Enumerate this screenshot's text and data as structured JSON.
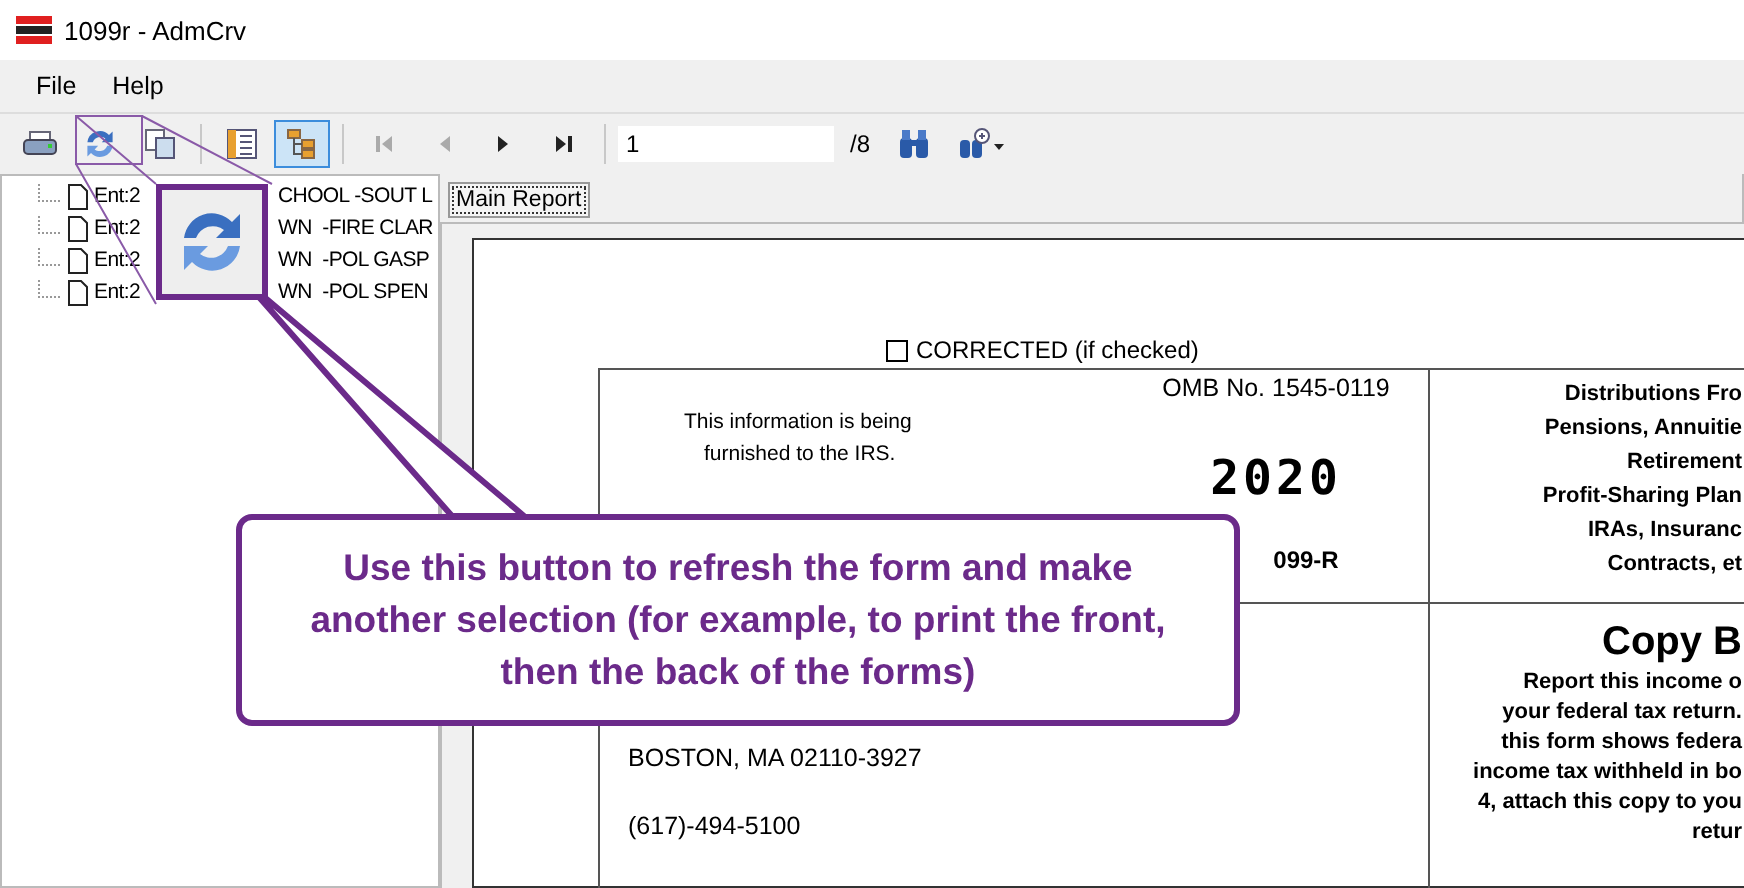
{
  "window": {
    "title": "1099r - AdmCrv"
  },
  "menu": [
    "File",
    "Help"
  ],
  "toolbar": [
    {
      "kind": "print"
    },
    {
      "kind": "refresh"
    },
    {
      "kind": "copy"
    },
    {
      "kind": "sep"
    },
    {
      "kind": "list",
      "pressed": false
    },
    {
      "kind": "tree",
      "pressed": true
    },
    {
      "kind": "sep"
    },
    {
      "kind": "first",
      "disabled": true
    },
    {
      "kind": "prev",
      "disabled": true
    },
    {
      "kind": "next",
      "disabled": false
    },
    {
      "kind": "last",
      "disabled": false
    },
    {
      "kind": "sep"
    }
  ],
  "page_field": {
    "value": "1",
    "total": "/8"
  },
  "tree": [
    {
      "start": "Ent:2",
      "end": "CHOOL -SOUT L"
    },
    {
      "start": "Ent:2",
      "end": "WN  -FIRE CLAR"
    },
    {
      "start": "Ent:2",
      "end": "WN  -POL GASP"
    },
    {
      "start": "Ent:2",
      "end": "WN  -POL SPEN"
    }
  ],
  "tabs": [
    {
      "label": "Main Report",
      "selected": true
    }
  ],
  "form": {
    "corrected": {
      "label": "CORRECTED (if checked)",
      "checked": false
    },
    "info": [
      "This information is being",
      "furnished to the IRS."
    ],
    "omb": "OMB No. 1545-0119",
    "year": "2020",
    "form_name": "099-R",
    "title_lines": [
      "Distributions Fro",
      "Pensions, Annuitie",
      "Retirement",
      "Profit-Sharing Plan",
      "IRAs, Insuranc",
      "Contracts, et"
    ],
    "address": "BOSTON, MA 02110-3927",
    "phone": "(617)-494-5100",
    "copy": "Copy B",
    "copy_lines": [
      "Report this income o",
      "your federal tax return.",
      "this form shows federa",
      "income tax withheld in bo",
      "4, attach this copy to you",
      "retur"
    ]
  },
  "callout": {
    "text": "Use this button to refresh the form and make another selection (for example, to print the front, then the back of the forms)"
  }
}
